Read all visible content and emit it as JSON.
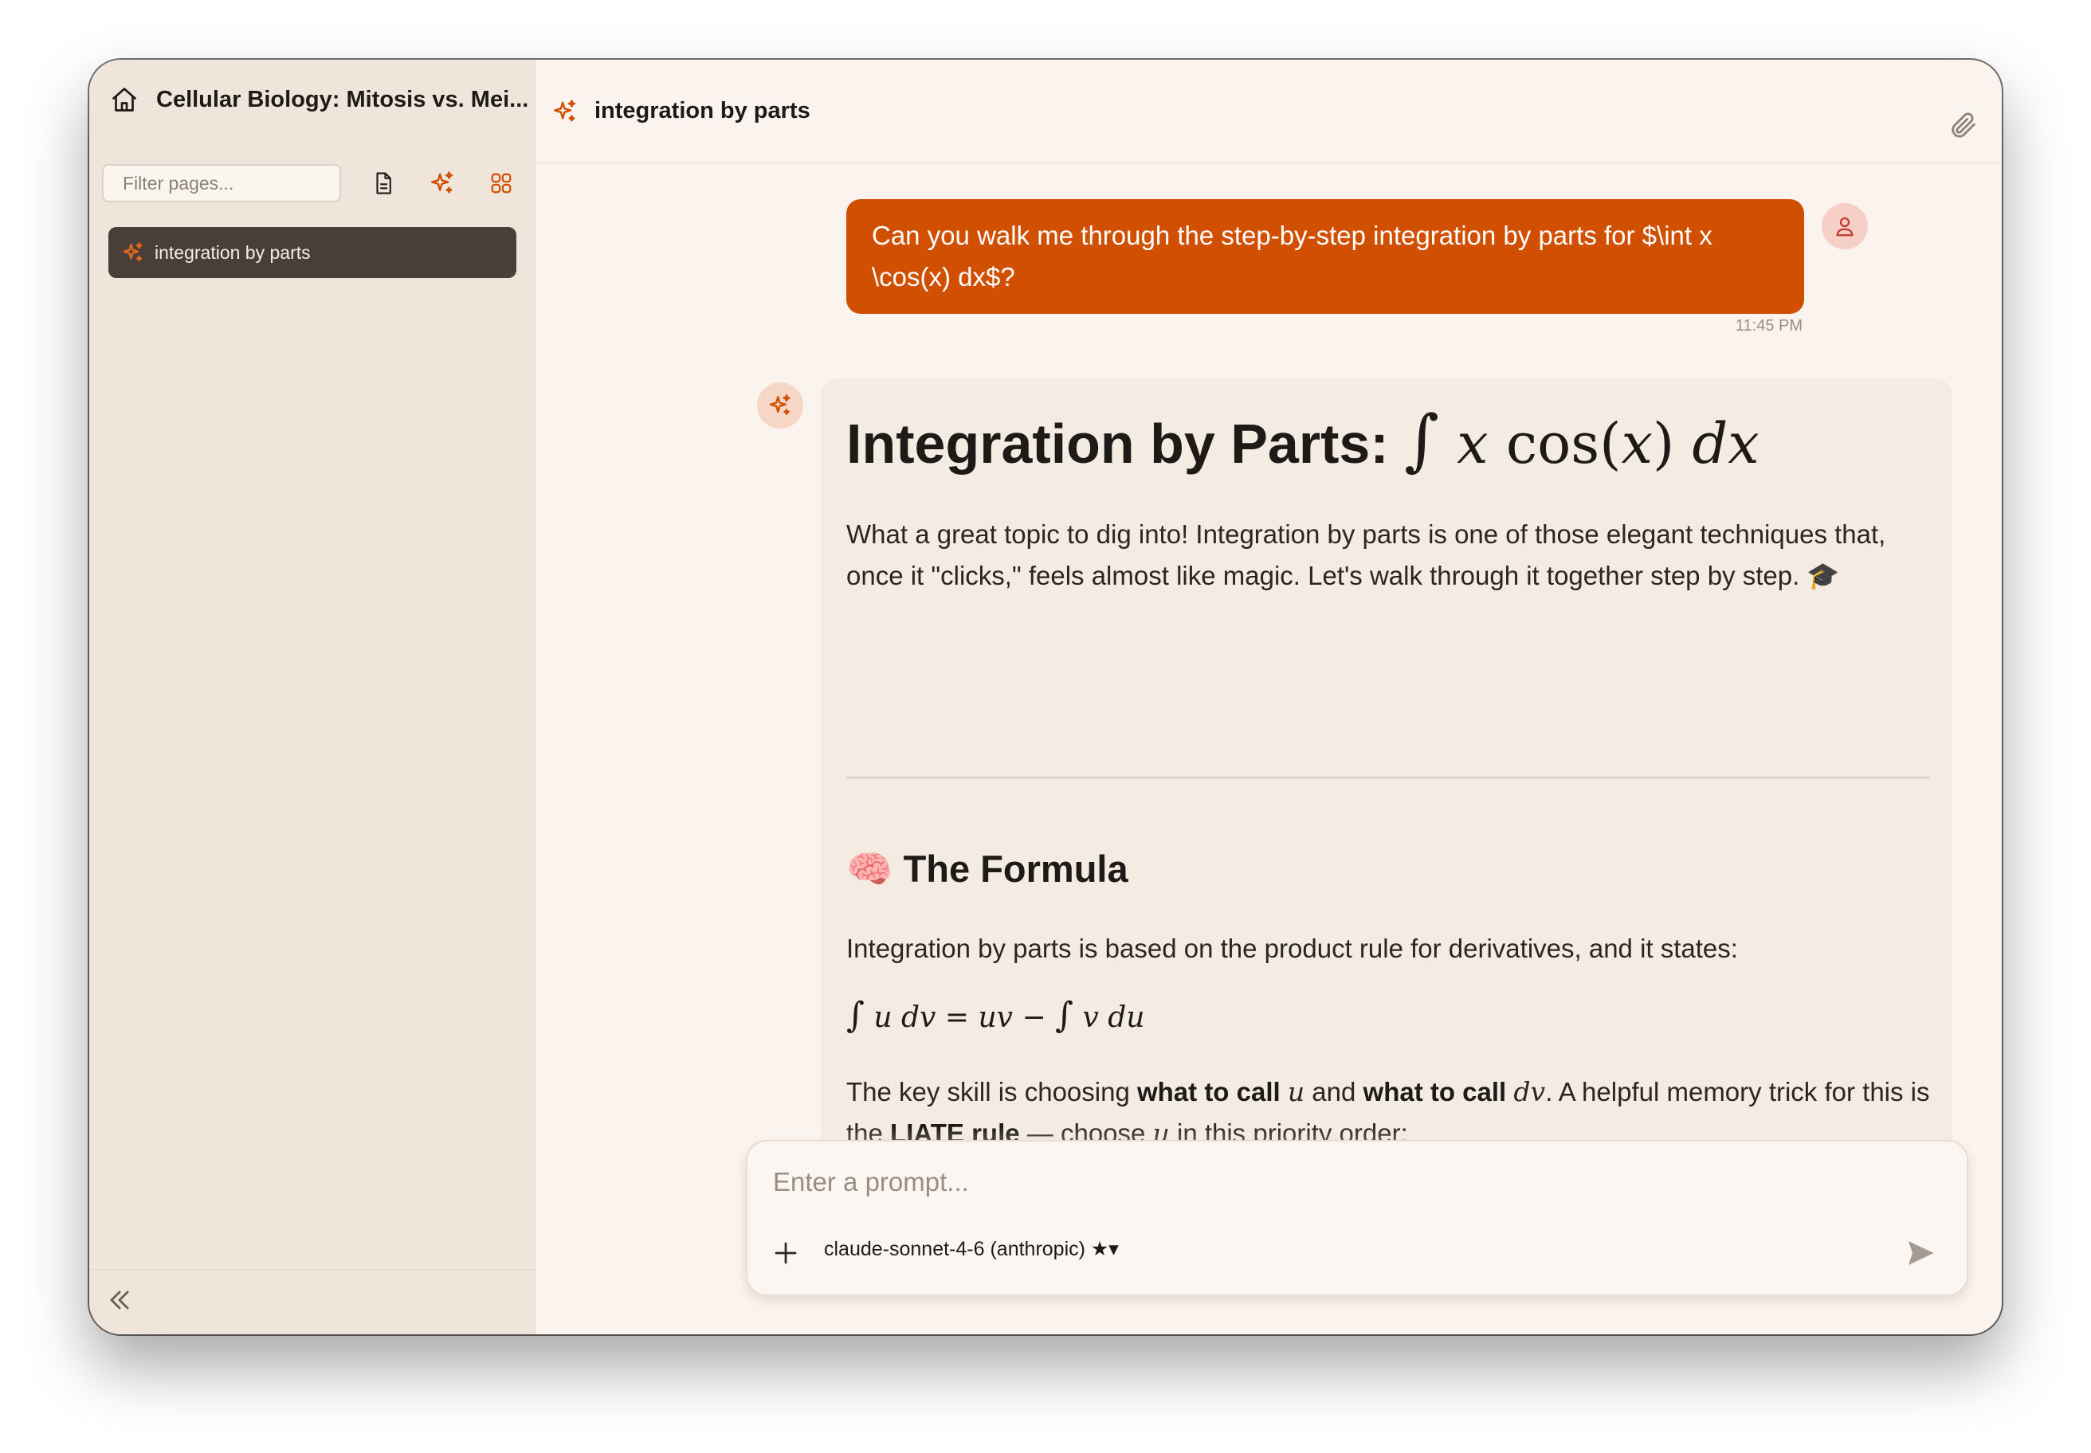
{
  "sidebar": {
    "title": "Cellular Biology: Mitosis vs. Mei...",
    "filter_placeholder": "Filter pages...",
    "pages": [
      {
        "label": "integration by parts",
        "active": true
      }
    ]
  },
  "header": {
    "title": "integration by parts"
  },
  "user_message": {
    "text": "Can you walk me through the step-by-step integration by parts for $\\int x \\cos(x) dx$?",
    "time": "11:45 PM"
  },
  "response": {
    "title_text": "Integration by Parts: ",
    "intro": "What a great topic to dig into! Integration by parts is one of those elegant techniques that, once it \"clicks,\" feels almost like magic. Let's walk through it together step by step. 🎓",
    "section_heading": "🧠 The Formula",
    "p1": "Integration by parts is based on the product rule for derivatives, and it states:",
    "p2_parts": {
      "a": "The key skill is choosing ",
      "b": "what to call",
      "c": " and ",
      "d": "what to call",
      "e": ". A helpful memory trick for this is the ",
      "f": "LIATE rule",
      "g": " — choose ",
      "h": " in this priority order:"
    }
  },
  "prompt": {
    "placeholder": "Enter a prompt...",
    "model": "claude-sonnet-4-6 (anthropic) ★▾"
  },
  "colors": {
    "accent": "#d14f00",
    "sidebar_bg": "#f0e5db",
    "active_item_bg": "#4a3f38",
    "main_bg": "#fbf3ed"
  }
}
